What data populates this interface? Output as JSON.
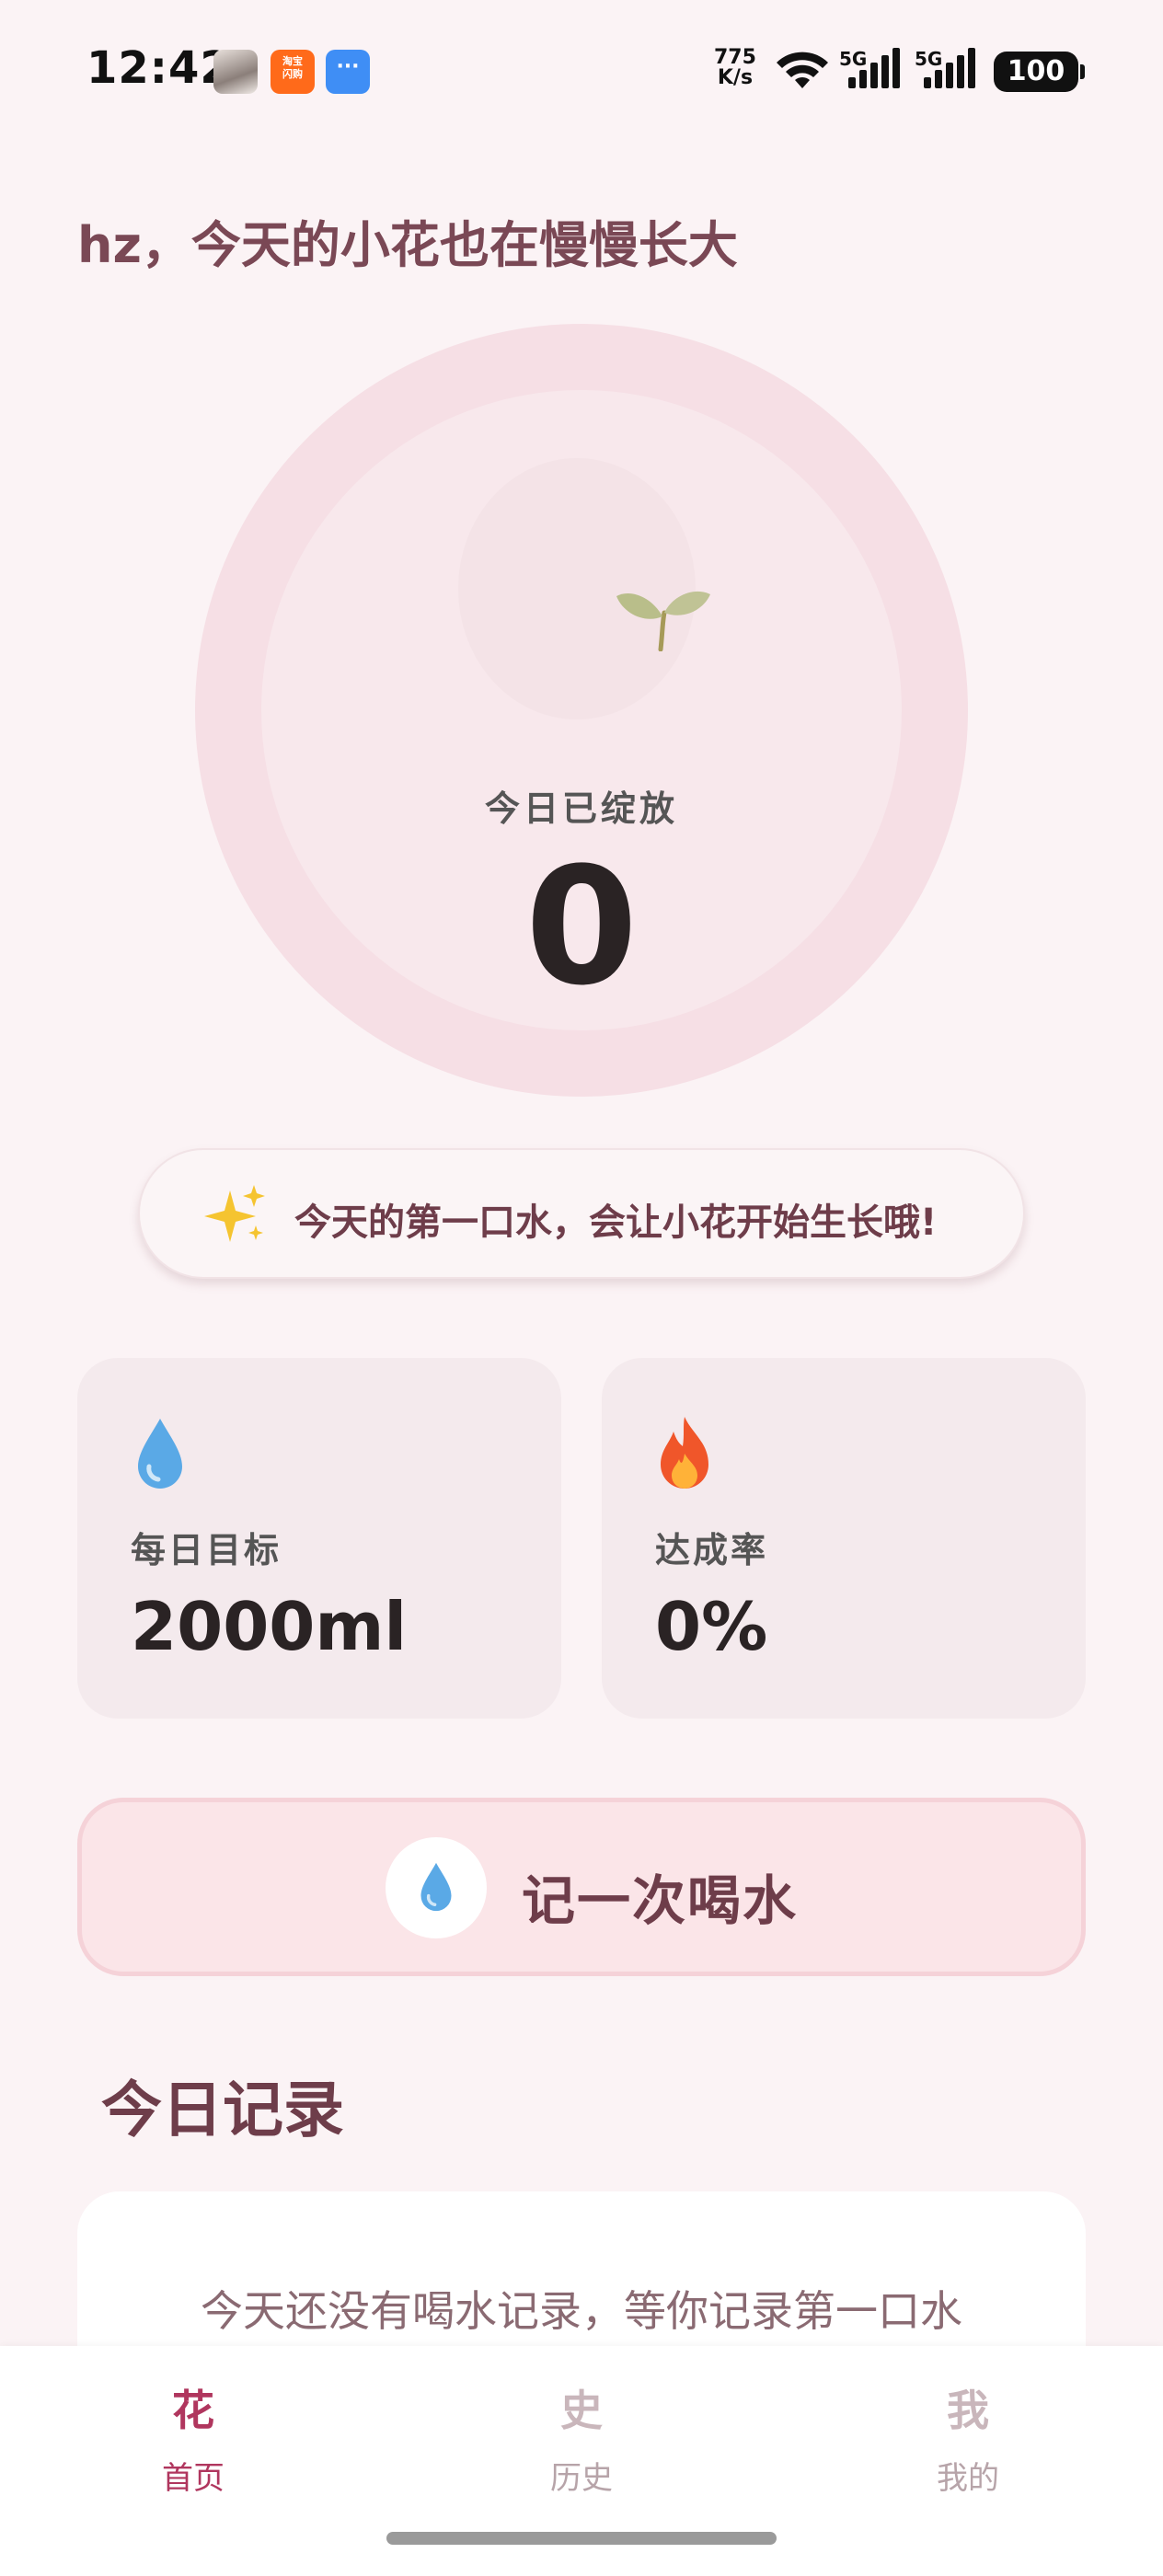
{
  "status_bar": {
    "time": "12:42",
    "net_speed_value": "775",
    "net_speed_unit": "K/s",
    "sim1": "5G",
    "sim2": "5G",
    "battery": "100",
    "icons": [
      "avatar-notification-icon",
      "taobao-notification-icon",
      "message-notification-icon",
      "wifi-icon",
      "signal-icon",
      "battery-icon"
    ]
  },
  "greeting": "hz，今天的小花也在慢慢长大",
  "progress": {
    "label": "今日已绽放",
    "count": "0",
    "icon": "sprout-icon"
  },
  "tip": {
    "icon": "sparkles-icon",
    "text": "今天的第一口水，会让小花开始生长哦!"
  },
  "stats": [
    {
      "icon": "water-drop-icon",
      "label": "每日目标",
      "value": "2000ml"
    },
    {
      "icon": "fire-icon",
      "label": "达成率",
      "value": "0%"
    }
  ],
  "record_button": {
    "icon": "water-drop-icon",
    "label": "记一次喝水"
  },
  "today_records": {
    "title": "今日记录",
    "empty_text": "今天还没有喝水记录，等你记录第一口水"
  },
  "bottom_nav": [
    {
      "glyph": "花",
      "label": "首页",
      "active": true
    },
    {
      "glyph": "史",
      "label": "历史",
      "active": false
    },
    {
      "glyph": "我",
      "label": "我的",
      "active": false
    }
  ],
  "colors": {
    "background": "#fbf3f5",
    "accent": "#b0365e",
    "title": "#6e3d4a",
    "ring": "#f6dfe5"
  }
}
